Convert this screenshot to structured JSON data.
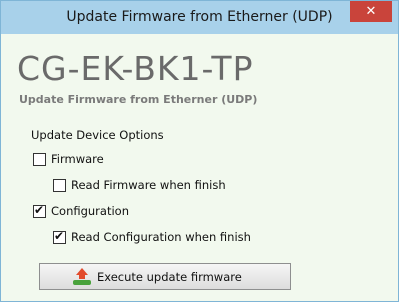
{
  "window": {
    "title": "Update Firmware from Etherner (UDP)",
    "close_symbol": "✕"
  },
  "header": {
    "device_name": "CG-EK-BK1-TP",
    "subtitle": "Update Firmware from Etherner (UDP)"
  },
  "options": {
    "section_label": "Update Device Options",
    "items": [
      {
        "label": "Firmware",
        "checked": false
      },
      {
        "label": "Read Firmware when finish",
        "checked": false
      },
      {
        "label": "Configuration",
        "checked": true
      },
      {
        "label": "Read Configuration when finish",
        "checked": true
      }
    ]
  },
  "action": {
    "button_label": "Execute update firmware",
    "icon": "upload-icon"
  },
  "colors": {
    "titlebar": "#a8d1ea",
    "close_button": "#c9443b",
    "background": "#f2f9ee"
  }
}
